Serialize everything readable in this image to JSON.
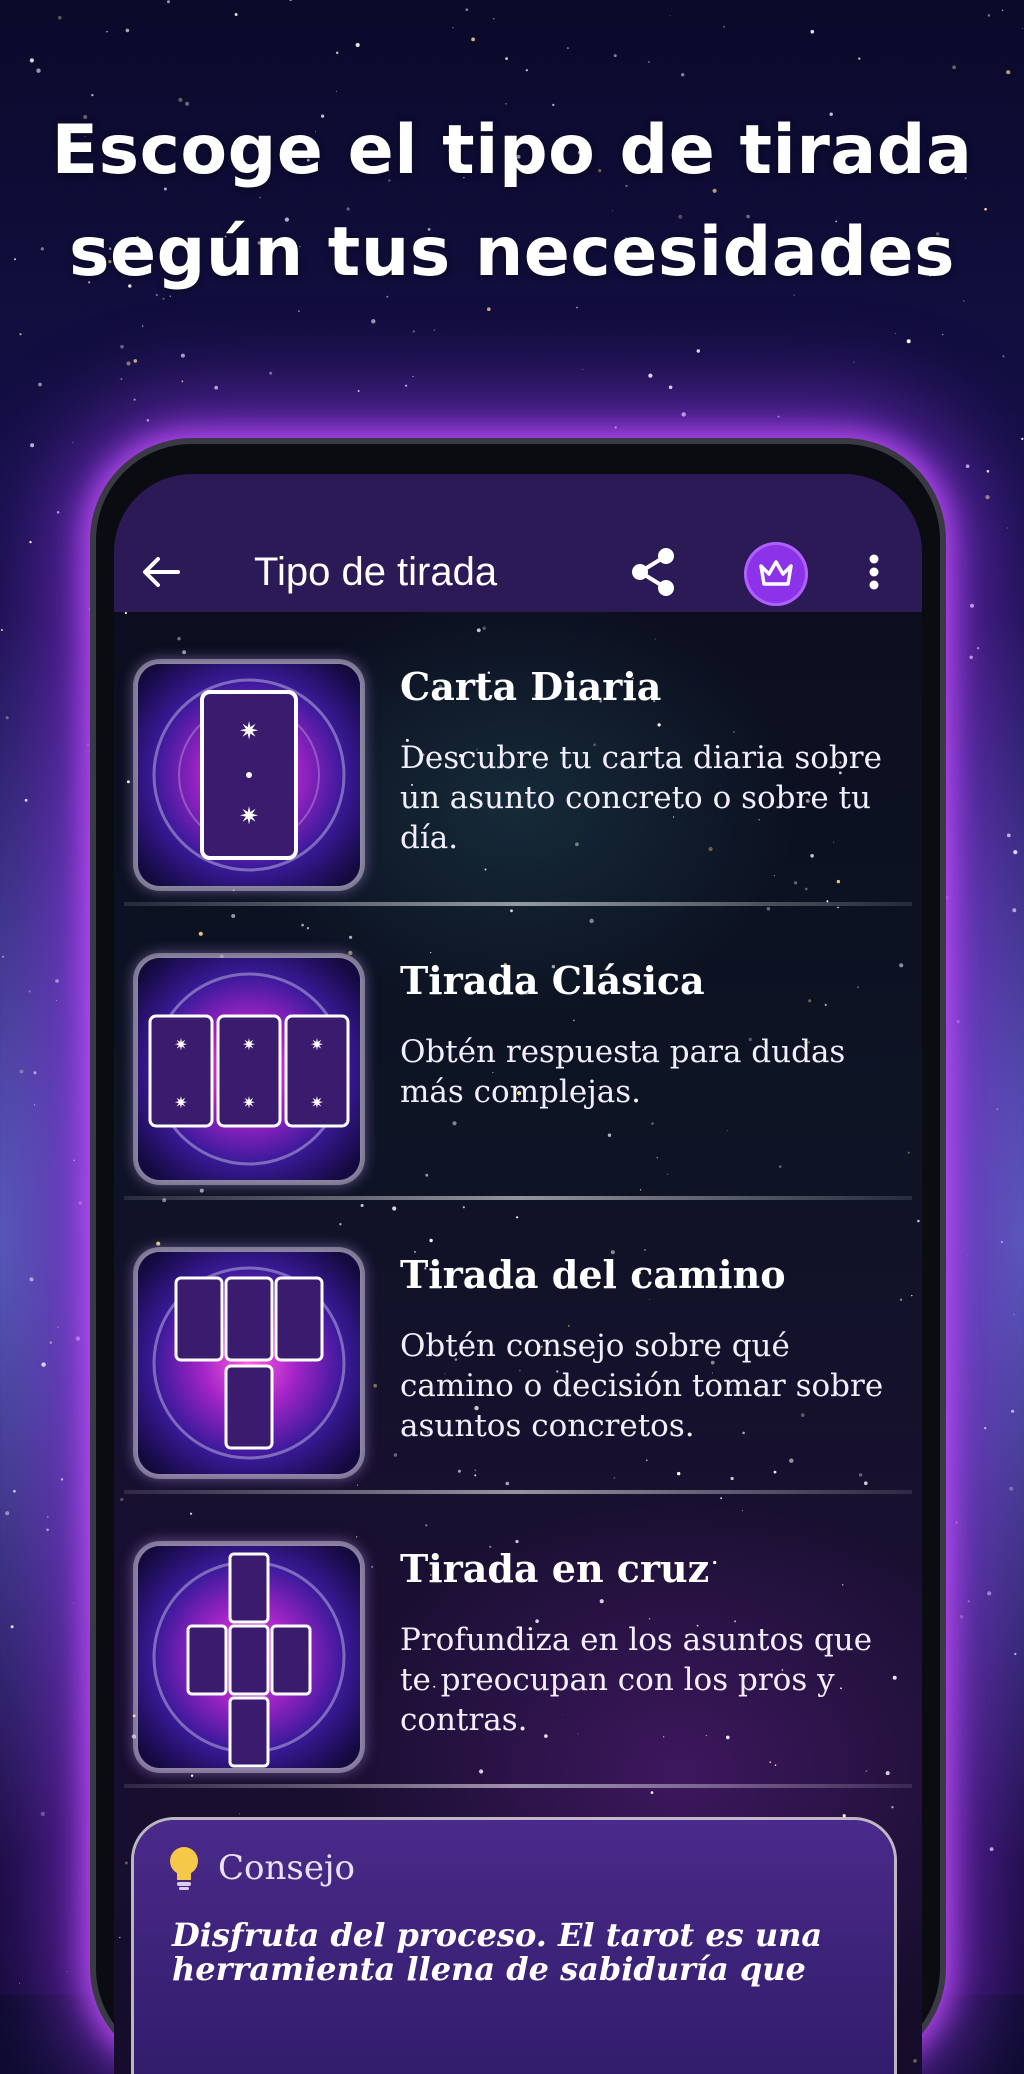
{
  "header": {
    "line1": "Escoge el tipo de tirada",
    "line2": "según tus necesidades"
  },
  "appbar": {
    "title": "Tipo de tirada",
    "back_icon": "arrow-left-icon",
    "share_icon": "share-icon",
    "premium_icon": "crown-icon",
    "menu_icon": "more-vert-icon"
  },
  "spreads": [
    {
      "title": "Carta Diaria",
      "description": "Descubre tu carta diaria sobre un asunto concreto o sobre tu día."
    },
    {
      "title": "Tirada Clásica",
      "description": "Obtén respuesta para dudas más complejas."
    },
    {
      "title": "Tirada del camino",
      "description": "Obtén consejo sobre qué camino o decisión tomar sobre asuntos concretos."
    },
    {
      "title": "Tirada en cruz",
      "description": "Profundiza en los asuntos que te preocupan con los pros y contras."
    }
  ],
  "tip": {
    "label": "Consejo",
    "text": "Disfruta del proceso. El tarot es una herramienta llena de sabiduría que"
  },
  "colors": {
    "appbar": "#2b1a56",
    "premium": "#8c32e8",
    "glow": "#c850ff"
  }
}
